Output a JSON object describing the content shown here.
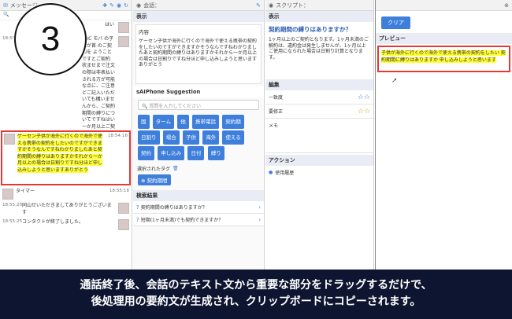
{
  "step_number": "3",
  "messages_panel": {
    "title": "メッセージ",
    "header_icons": [
      "plus-icon",
      "edit-icon",
      "eye-icon",
      "refresh-icon"
    ],
    "messages": [
      {
        "time": "",
        "text": "はい",
        "highlight": false
      },
      {
        "time": "18:55:",
        "text": "ABC モバ の子様が首 のご契約を ようことですとご契約 状ませまで注文の際は非表払いされる方が可能な点に、ご注意どご記入いただいても構いませんから、ご契約期間の縛りについてですねはい一か月以上ご契約をおもまって1か月未満でご解約される場合は違約金がございませんが一か月以上の場合は日割り計算となります",
        "highlight": false
      },
      {
        "time": "18:54:16",
        "text": "ゲーセン子供が海外に行くので海外で使える携帯の契約をしたいのですができますかそうなんですねわかりましたあと契約期間の縛りはありますかそれから一か月以上の場合は日割りですね分ほど申し込みしようと思いますありがとう",
        "highlight": true
      },
      {
        "time": "18:55:18",
        "text": "タイマー",
        "highlight": false
      },
      {
        "time": "18:55:20",
        "text": "同山せいただきましてありがとうございます",
        "highlight": false
      },
      {
        "time": "18:55:25",
        "text": "コンタクトが終了しました。",
        "highlight": false
      }
    ]
  },
  "conversation_panel": {
    "title": "会話：",
    "display_label": "表示",
    "content_label": "内容",
    "content_text": "ゲーセン子供が海外に行くので海外で使える携帯の契約をしたいのですができますかそうなんですねわかりましたあと契約期間の縛りはありますかそれから一か月以上の場合は日割りですね分ほど申し込みしようと思いますありがとう",
    "suggestion_title": "sAIPhone Suggestion",
    "search_placeholder": "質問を入力してください",
    "tags": [
      "国",
      "ターム",
      "他",
      "携帯電話",
      "契約期",
      "日割り",
      "場合",
      "子供",
      "海外",
      "使える",
      "契約",
      "申し込み",
      "日付",
      "縛り"
    ],
    "selected_tags_label": "選択されたタグ",
    "selected_tag": "契約期間",
    "results_label": "検索結果",
    "results": [
      "契約期間の縛りはありますか？",
      "短期(1ヶ月未満)でも契約できますか？"
    ]
  },
  "script_panel": {
    "title": "スクリプト：",
    "display_label": "表示",
    "script_title": "契約期間の縛りはありますか？",
    "script_body": "1ヶ月以上のご契約となります。1ヶ月未満のご解約は、違約金は発生しませんが、1ヶ月以上ご使用になられた場合は日割り計算となります。",
    "eval_label": "編集",
    "eval_rows": [
      "一致度",
      "要修正",
      "メモ"
    ],
    "action_label": "アクション",
    "action_item": "使用履歴"
  },
  "preview_panel": {
    "clear_button": "クリア",
    "preview_label": "プレビュー",
    "preview_text": "子供が海外に行くので海外で使える携帯の契約をしたい 契約期間に縛りはありますか 申し込みしようと思います"
  },
  "caption": {
    "line1": "通話終了後、会話のテキスト文から重要な部分をドラッグするだけで、",
    "line2": "後処理用の要約文が生成され、クリップボードにコピーされます。"
  },
  "colors": {
    "accent": "#3f7fdc",
    "highlight_box": "#e53935",
    "caption_bg": "#0e1530"
  }
}
